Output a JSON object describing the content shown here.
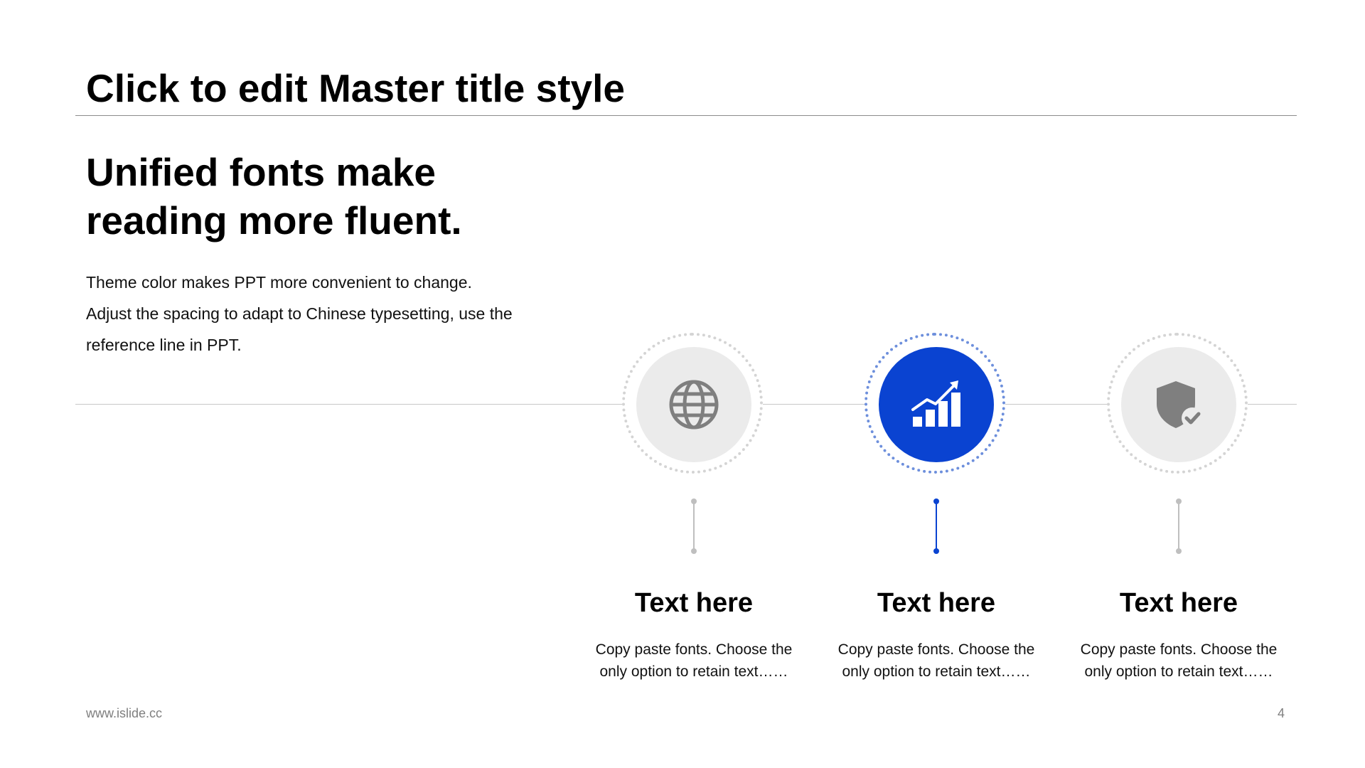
{
  "slide": {
    "title": "Click to edit Master title style",
    "headline": [
      "Unified fonts make",
      "reading more fluent."
    ],
    "body_lines": [
      "Theme color makes PPT more convenient to change.",
      "Adjust the spacing to adapt to Chinese typesetting, use the",
      "reference line in PPT."
    ]
  },
  "steps": [
    {
      "icon": "globe-icon",
      "title": "Text here",
      "desc": [
        "Copy paste fonts. Choose the",
        "only option to retain text……"
      ],
      "active": false
    },
    {
      "icon": "growth-chart-icon",
      "title": "Text here",
      "desc": [
        "Copy paste fonts. Choose the",
        "only option to retain text……"
      ],
      "active": true
    },
    {
      "icon": "shield-check-icon",
      "title": "Text here",
      "desc": [
        "Copy paste fonts. Choose the",
        "only option to retain text……"
      ],
      "active": false
    }
  ],
  "footer": {
    "website": "www.islide.cc",
    "page_number": "4"
  },
  "colors": {
    "accent": "#0a43d1",
    "accent_ring": "#6d8fdc",
    "inactive_disc": "#ebebeb",
    "inactive_icon": "#7f7f7f",
    "inactive_connector": "#bfbfbf"
  }
}
